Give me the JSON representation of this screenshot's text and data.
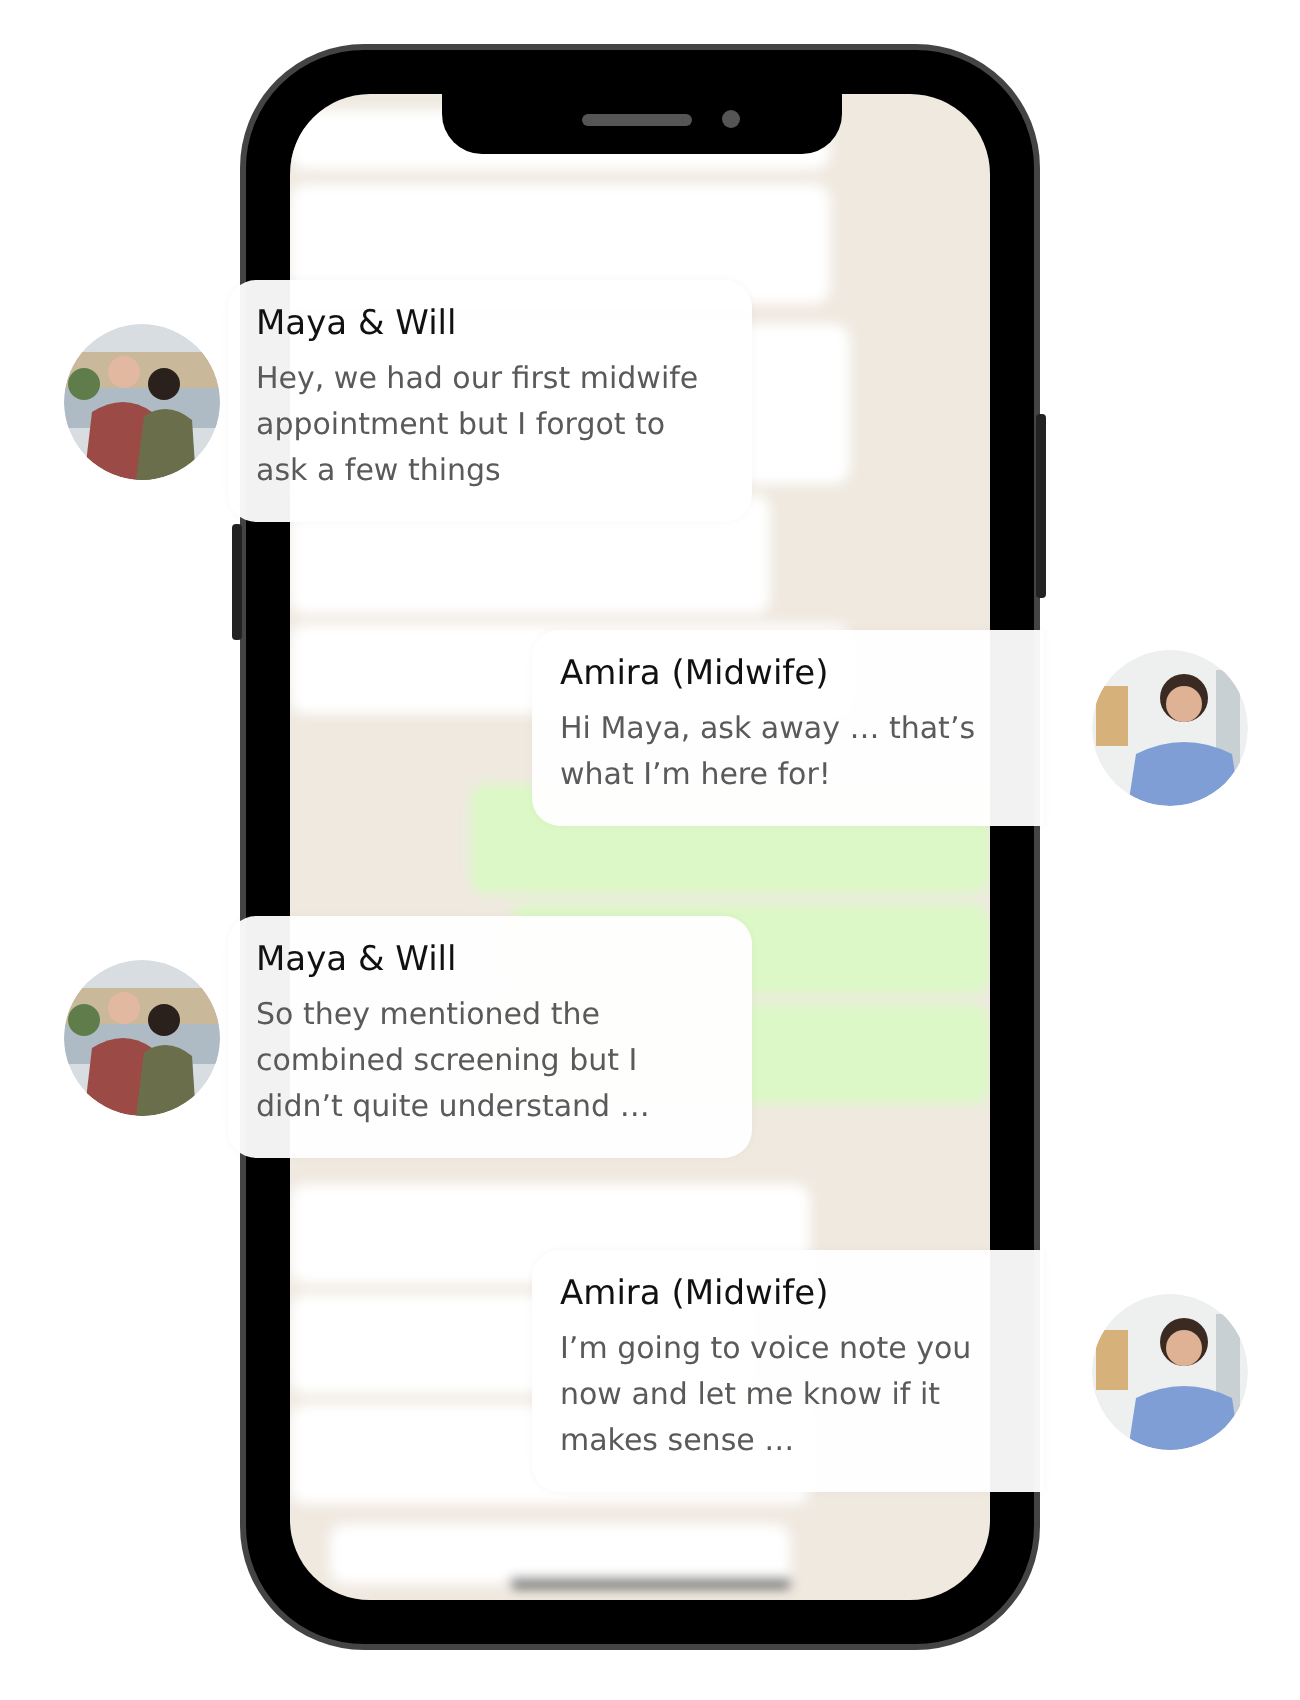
{
  "messages": [
    {
      "sender": "Maya & Will",
      "text": "Hey, we had our first midwife appointment but I forgot to ask a few things",
      "kind": "left"
    },
    {
      "sender": "Amira (Midwife)",
      "text": "Hi Maya, ask away … that’s what I’m here for!",
      "kind": "right"
    },
    {
      "sender": "Maya & Will",
      "text": "So they mentioned the combined screening but I didn’t quite understand …",
      "kind": "left"
    },
    {
      "sender": "Amira (Midwife)",
      "text": "I’m going to voice note you now and let me know if it makes sense …",
      "kind": "right"
    }
  ]
}
